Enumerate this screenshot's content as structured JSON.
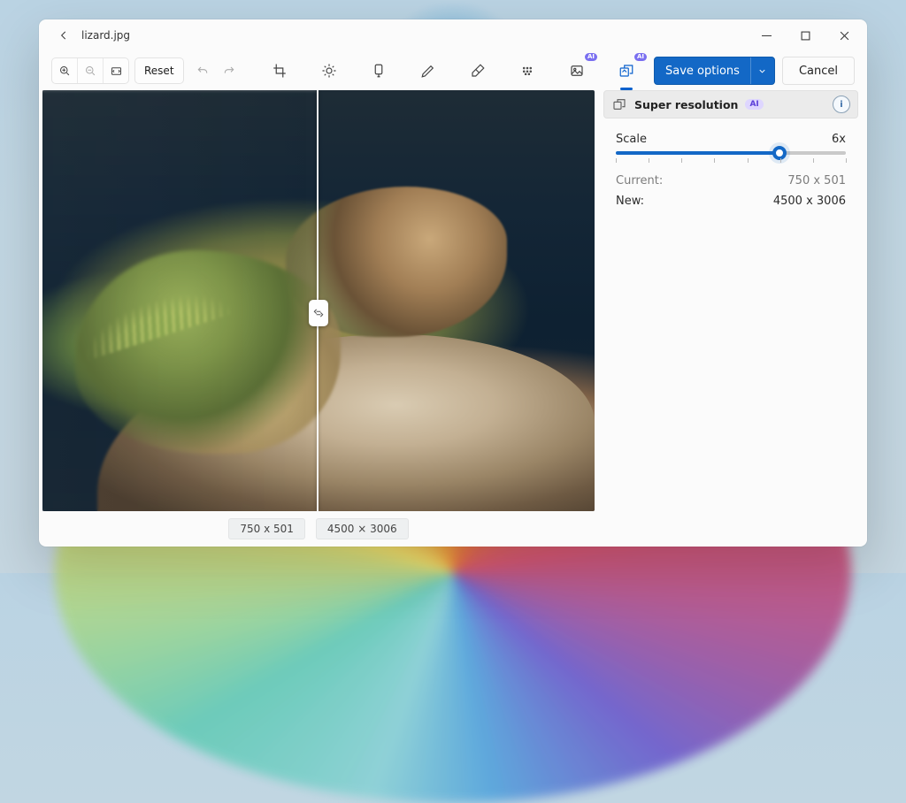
{
  "titlebar": {
    "filename": "lizard.jpg"
  },
  "toolbar": {
    "reset_label": "Reset",
    "save_label": "Save options",
    "cancel_label": "Cancel",
    "ai_badge": "AI"
  },
  "compare": {
    "left_dim": "750 x 501",
    "right_dim": "4500 × 3006"
  },
  "panel": {
    "title": "Super resolution",
    "ai_badge": "AI",
    "scale_label": "Scale",
    "scale_value": "6x",
    "current_label": "Current:",
    "current_value": "750 x 501",
    "new_label": "New:",
    "new_value": "4500 x 3006",
    "slider_percent": 71,
    "slider_stops": 8
  },
  "colors": {
    "accent": "#1368c6"
  }
}
